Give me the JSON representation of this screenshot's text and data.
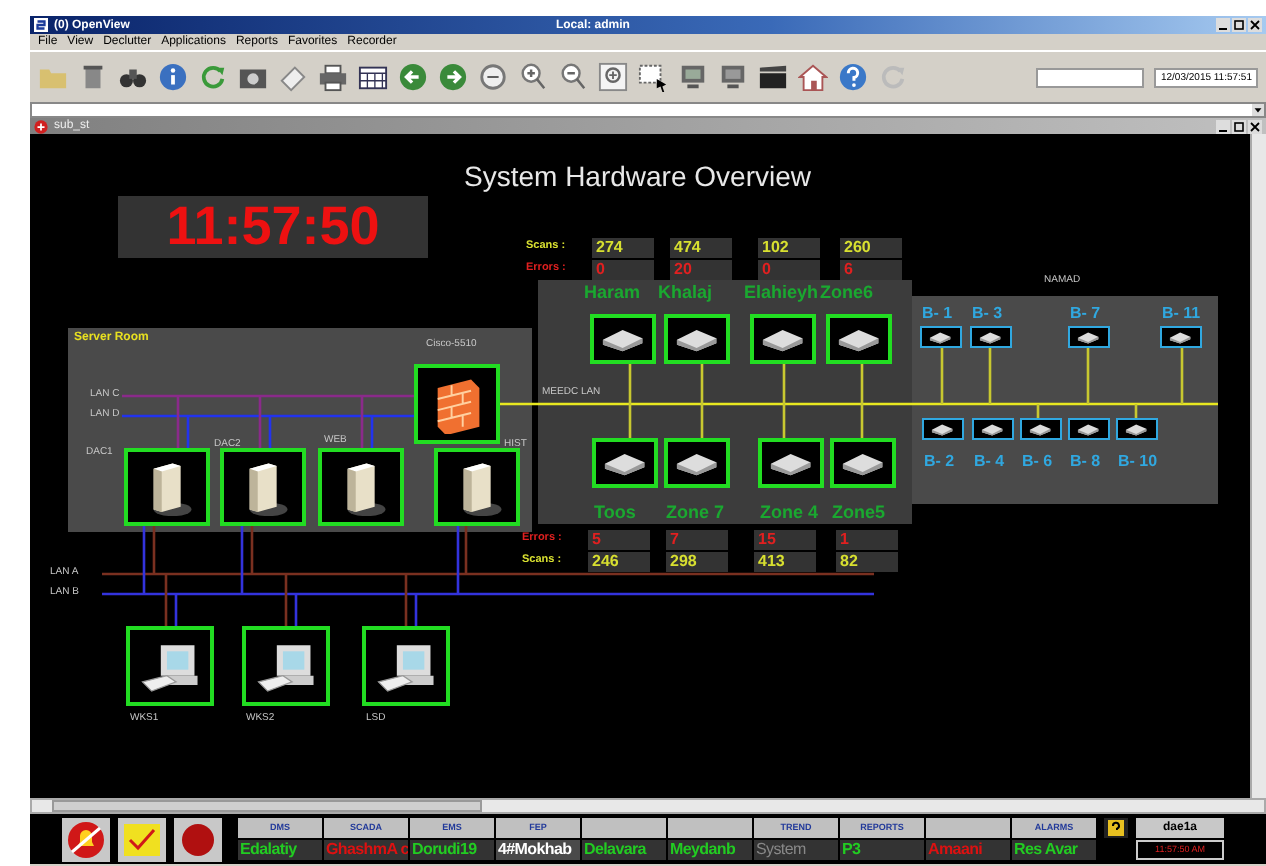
{
  "window": {
    "title": "(0) OpenView",
    "user": "Local: admin"
  },
  "menu": [
    "File",
    "View",
    "Declutter",
    "Applications",
    "Reports",
    "Favorites",
    "Recorder"
  ],
  "toolbar": {
    "datetime": "12/03/2015 11:57:51"
  },
  "subwindow": {
    "title": "sub_st"
  },
  "display": {
    "title": "System Hardware Overview",
    "clock": "11:57:50"
  },
  "server_room": {
    "label": "Server Room",
    "firewall": "Cisco-5510",
    "lans": [
      "LAN C",
      "LAN D"
    ],
    "servers": [
      "DAC1",
      "DAC2",
      "WEB",
      "HIST"
    ]
  },
  "meedc_lan": "MEEDC LAN",
  "top_stats": {
    "scans_label": "Scans :",
    "errors_label": "Errors :",
    "columns": [
      {
        "scans": "274",
        "errors": "0"
      },
      {
        "scans": "474",
        "errors": "20"
      },
      {
        "scans": "102",
        "errors": "0"
      },
      {
        "scans": "260",
        "errors": "6"
      }
    ]
  },
  "top_sites": [
    "Haram",
    "Khalaj",
    "Elahieyh",
    "Zone6"
  ],
  "bottom_sites": [
    "Toos",
    "Zone 7",
    "Zone 4",
    "Zone5"
  ],
  "bottom_stats": {
    "errors_label": "Errors :",
    "scans_label": "Scans :",
    "columns": [
      {
        "errors": "5",
        "scans": "246"
      },
      {
        "errors": "7",
        "scans": "298"
      },
      {
        "errors": "15",
        "scans": "413"
      },
      {
        "errors": "1",
        "scans": "82"
      }
    ]
  },
  "namad": {
    "label": "NAMAD",
    "top": [
      "B- 1",
      "B- 3",
      "B- 7",
      "B- 11"
    ],
    "bottom": [
      "B- 2",
      "B- 4",
      "B- 6",
      "B- 8",
      "B- 10"
    ]
  },
  "lans": [
    "LAN A",
    "LAN B"
  ],
  "workstations": [
    "WKS1",
    "WKS2",
    "LSD"
  ],
  "panel": {
    "cells": [
      {
        "label": "DMS",
        "value": "Edalatiy",
        "alarm": false,
        "selected": false,
        "disabled": false
      },
      {
        "label": "SCADA",
        "value": "GhashmA c",
        "alarm": true,
        "selected": false,
        "disabled": false
      },
      {
        "label": "EMS",
        "value": "Dorudi19",
        "alarm": false,
        "selected": false,
        "disabled": false
      },
      {
        "label": "FEP",
        "value": "4#Mokhab",
        "alarm": false,
        "selected": true,
        "disabled": false
      },
      {
        "value": "Delavara",
        "alarm": false,
        "selected": false,
        "disabled": false
      },
      {
        "value": "Meydanb",
        "alarm": false,
        "selected": false,
        "disabled": false
      },
      {
        "label": "TREND",
        "value": "System",
        "alarm": false,
        "selected": false,
        "disabled": true
      },
      {
        "label": "REPORTS",
        "value": "P3",
        "alarm": false,
        "selected": false,
        "disabled": false
      },
      {
        "value": "Amaani",
        "alarm": true,
        "selected": false,
        "disabled": false
      },
      {
        "label": "ALARMS",
        "value": "Res Avar",
        "alarm": false,
        "selected": false,
        "disabled": false
      }
    ],
    "user": "dae1a",
    "time": "11:57:50 AM"
  }
}
